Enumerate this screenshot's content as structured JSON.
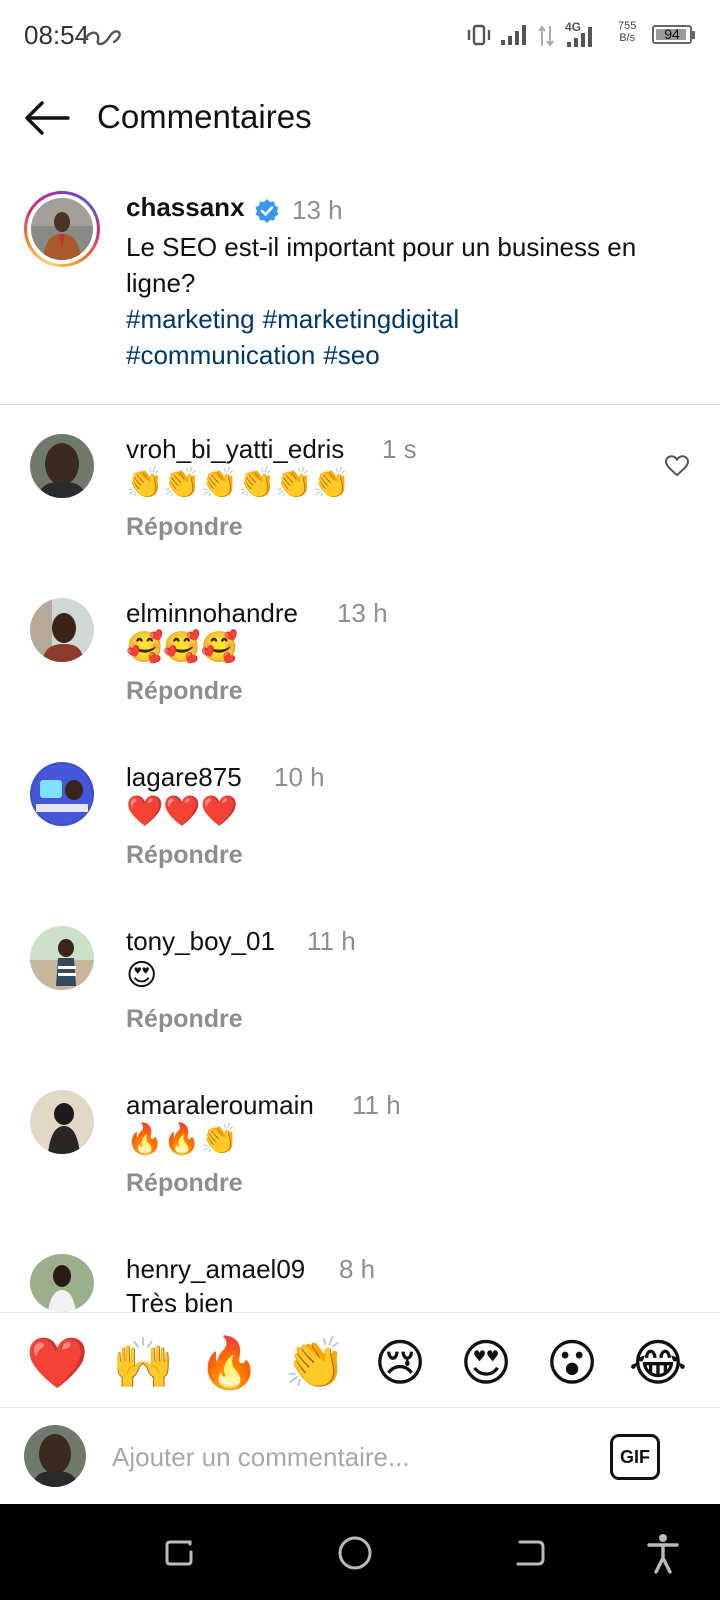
{
  "status_bar": {
    "time": "08:54",
    "network": "4G",
    "speed_value": "755",
    "speed_unit": "B/s",
    "battery": "94",
    "battery_level": 0.94
  },
  "header": {
    "title": "Commentaires"
  },
  "post": {
    "username": "chassanx",
    "time": "13 h",
    "text": "Le SEO est-il important pour un business en ligne?",
    "hashtags": [
      "#marketing",
      "#marketingdigital",
      "#communication",
      "#seo"
    ]
  },
  "reply_label": "Répondre",
  "comments": [
    {
      "username": "vroh_bi_yatti_edris",
      "time": "1 s",
      "text": "👏👏👏👏👏👏"
    },
    {
      "username": "elminnohandre",
      "time": "13 h",
      "text": "🥰🥰🥰"
    },
    {
      "username": "lagare875",
      "time": "10 h",
      "text": "❤️❤️❤️"
    },
    {
      "username": "tony_boy_01",
      "time": "11 h",
      "text": "😍"
    },
    {
      "username": "amaraleroumain",
      "time": "11 h",
      "text": "🔥🔥👏"
    },
    {
      "username": "henry_amael09",
      "time": "8 h",
      "text": "Très bien"
    }
  ],
  "emoji_bar": [
    "❤️",
    "🙌",
    "🔥",
    "👏",
    "😢",
    "😍",
    "😮",
    "😂"
  ],
  "comment_input": {
    "placeholder": "Ajouter un commentaire..."
  },
  "gif_label": "GIF",
  "colors": {
    "hashtag": "#00376b",
    "verified": "#3897f0",
    "muted": "#8e8e8e"
  }
}
